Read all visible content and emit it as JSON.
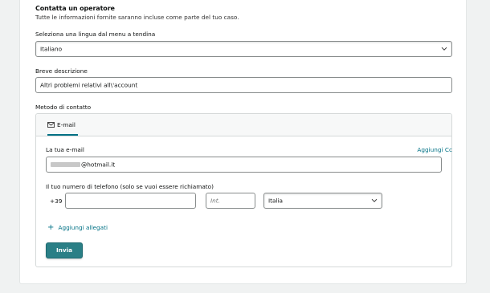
{
  "section": {
    "title": "Contatta un operatore",
    "subtitle": "Tutte le informazioni fornite saranno incluse come parte del tuo caso."
  },
  "language": {
    "label": "Seleziona una lingua dal menu a tendina",
    "selected": "Italiano"
  },
  "description": {
    "label": "Breve descrizione",
    "value": "Altri problemi relativi all\\'account"
  },
  "contact": {
    "label": "Metodo di contatto",
    "tab": "E-mail",
    "email_label": "La tua e-mail",
    "add_cc": "Aggiungi Cc",
    "email_value": "@hotmail.it",
    "phone_label": "Il tuo numero di telefono (solo se vuoi essere richiamato)",
    "country_code": "+39",
    "ext_placeholder": "Int.",
    "country": "Italia",
    "attachments": "Aggiungi allegati",
    "submit": "Invia"
  },
  "colors": {
    "accent": "#007185",
    "button": "#2a7f86",
    "border": "#888c8c"
  },
  "icons": [
    "chevron-down-icon",
    "envelope-icon",
    "plus-icon"
  ]
}
